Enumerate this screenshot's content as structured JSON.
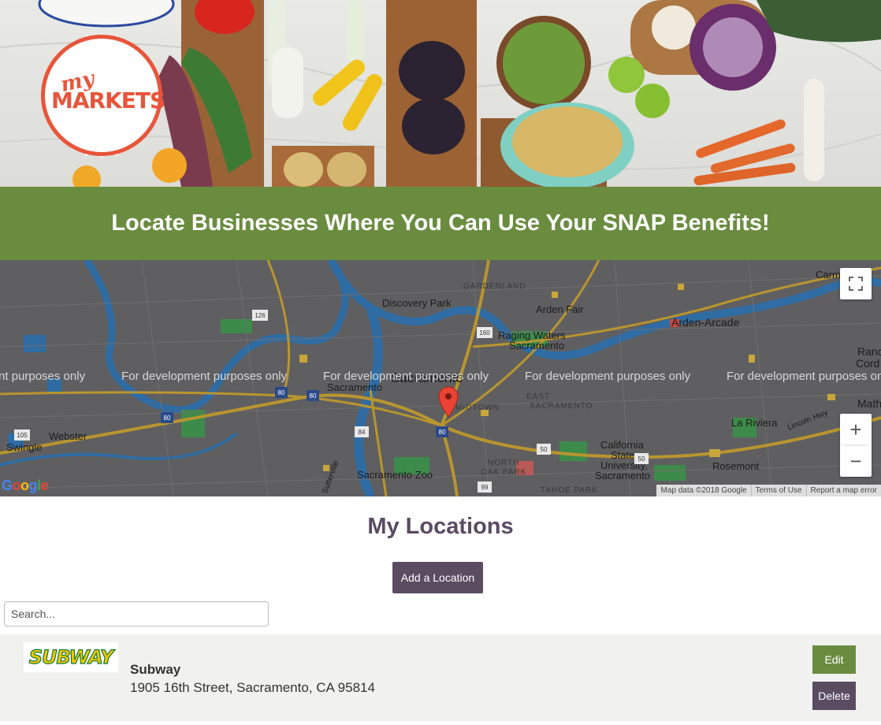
{
  "hero": {
    "logo_my": "my",
    "logo_markets": "MARKETS"
  },
  "banner": {
    "heading": "Locate Businesses Where You Can Use Your SNAP Benefits!"
  },
  "map": {
    "place_labels": {
      "carmichael": "Carmichae",
      "gardenland": "GARDENLAND",
      "discovery_park": "Discovery Park",
      "arden_fair": "Arden Fair",
      "arden_arcade": "Arden-Arcade",
      "raging_waters": "Raging Waters",
      "raging_waters_2": "Sacramento",
      "rancho": "Ranc",
      "rancho_2": "Cord",
      "sacramento": "Sacramento",
      "west_sacramento": "Sacramento",
      "midtown": "MIDTOWN",
      "east_sacramento": "EAST",
      "east_sacramento_2": "SACRAMENTO",
      "webster": "Webster",
      "swingle": "Swingle",
      "la_riviera": "La Riviera",
      "csus": "California",
      "csus_2": "State",
      "csus_3": "University,",
      "csus_4": "Sacramento",
      "rosemont": "Rosemont",
      "north_oak_park": "NORTH",
      "north_oak_park_2": "OAK PARK",
      "sacramento_zoo": "Sacramento Zoo",
      "tahoe_park": "TAHOE PARK",
      "mather": "Math",
      "lincoln_hwy": "Lincoln Hwy",
      "sutterville": "Sutterville"
    },
    "watermark": [
      "nt purposes only",
      "For development purposes only",
      "For development purposes only",
      "For development purposes only",
      "For development purposes only"
    ],
    "highway_shields": [
      "126",
      "160",
      "80",
      "105",
      "80",
      "80",
      "84",
      "80",
      "50",
      "99",
      "50"
    ],
    "zoom_in": "+",
    "zoom_out": "−",
    "google_logo": [
      "G",
      "o",
      "o",
      "g",
      "l",
      "e"
    ],
    "footer": {
      "map_data": "Map data ©2018 Google",
      "terms": "Terms of Use",
      "report": "Report a map error"
    },
    "colors": {
      "map_bg": "#5f5f61",
      "water": "#2f6ca3",
      "park": "#3d8b4a",
      "highway": "#b8952f"
    }
  },
  "locations": {
    "title": "My Locations",
    "add_button": "Add a Location",
    "search_placeholder": "Search...",
    "items": [
      {
        "logo_text": "SUBWAY",
        "name": "Subway",
        "address": "1905 16th Street, Sacramento, CA 95814",
        "edit_label": "Edit",
        "delete_label": "Delete"
      }
    ]
  }
}
